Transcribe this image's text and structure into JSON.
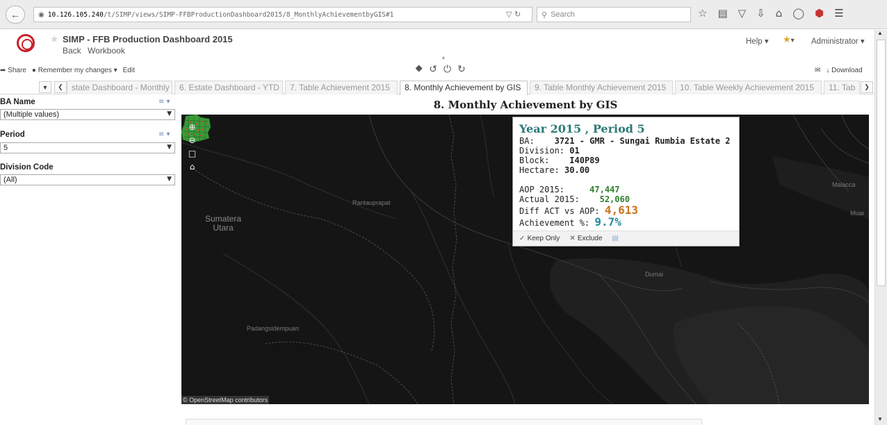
{
  "browser": {
    "url_host": "10.126.105.240",
    "url_path": "/t/SIMP/views/SIMP-FFBProductionDashboard2015/8_MonthlyAchievementbyGIS#1",
    "search_placeholder": "Search"
  },
  "header": {
    "title": "SIMP - FFB Production Dashboard 2015",
    "back_label": "Back",
    "workbook_label": "Workbook",
    "help_label": "Help ▾",
    "favorites_label": "▾",
    "user_label": "Administrator ▾"
  },
  "toolbar": {
    "share_label": "Share",
    "remember_label": "Remember my changes ▾",
    "edit_label": "Edit",
    "download_label": "Download"
  },
  "tabs": [
    {
      "label": "state Dashboard - Monthly"
    },
    {
      "label": "6. Estate Dashboard - YTD"
    },
    {
      "label": "7. Table Achievement 2015"
    },
    {
      "label": "8. Monthly Achievement by GIS"
    },
    {
      "label": "9. Table Monthly Achievement 2015"
    },
    {
      "label": "10. Table Weekly Achievement 2015"
    },
    {
      "label": "11. Tab"
    }
  ],
  "filters": {
    "ba_name": {
      "label": "BA Name",
      "value": "(Multiple values)"
    },
    "period": {
      "label": "Period",
      "value": "5"
    },
    "division_code": {
      "label": "Division Code",
      "value": "(All)"
    }
  },
  "viz": {
    "title": "8. Monthly Achievement by GIS"
  },
  "map": {
    "labels": {
      "sumatera": "Sumatera\nUtara",
      "rantauprapat": "Rantauprapat",
      "padangsidempuan": "Padangsidempuan",
      "malacca": "Malacca",
      "muar": "Muar",
      "dumai": "Dumai"
    },
    "attribution": "© OpenStreetMap contributors",
    "estate_color": "#3a9a3a",
    "background_color": "#121212"
  },
  "tooltip": {
    "title": "Year 2015 , Period  5",
    "ba_label": "BA:",
    "ba_value": "3721 - GMR - Sungai Rumbia Estate 2",
    "division_label": "Division:",
    "division_value": "01",
    "block_label": "Block:",
    "block_value": "I40P89",
    "hectare_label": "Hectare:",
    "hectare_value": "30.00",
    "aop_label": "AOP 2015:",
    "aop_value": "47,447",
    "actual_label": "Actual 2015:",
    "actual_value": "52,060",
    "diff_label": "Diff ACT vs AOP:",
    "diff_value": "4,613",
    "achievement_label": "Achievement %:",
    "achievement_value": "9.7%",
    "keep_only_label": "Keep Only",
    "exclude_label": "Exclude"
  }
}
